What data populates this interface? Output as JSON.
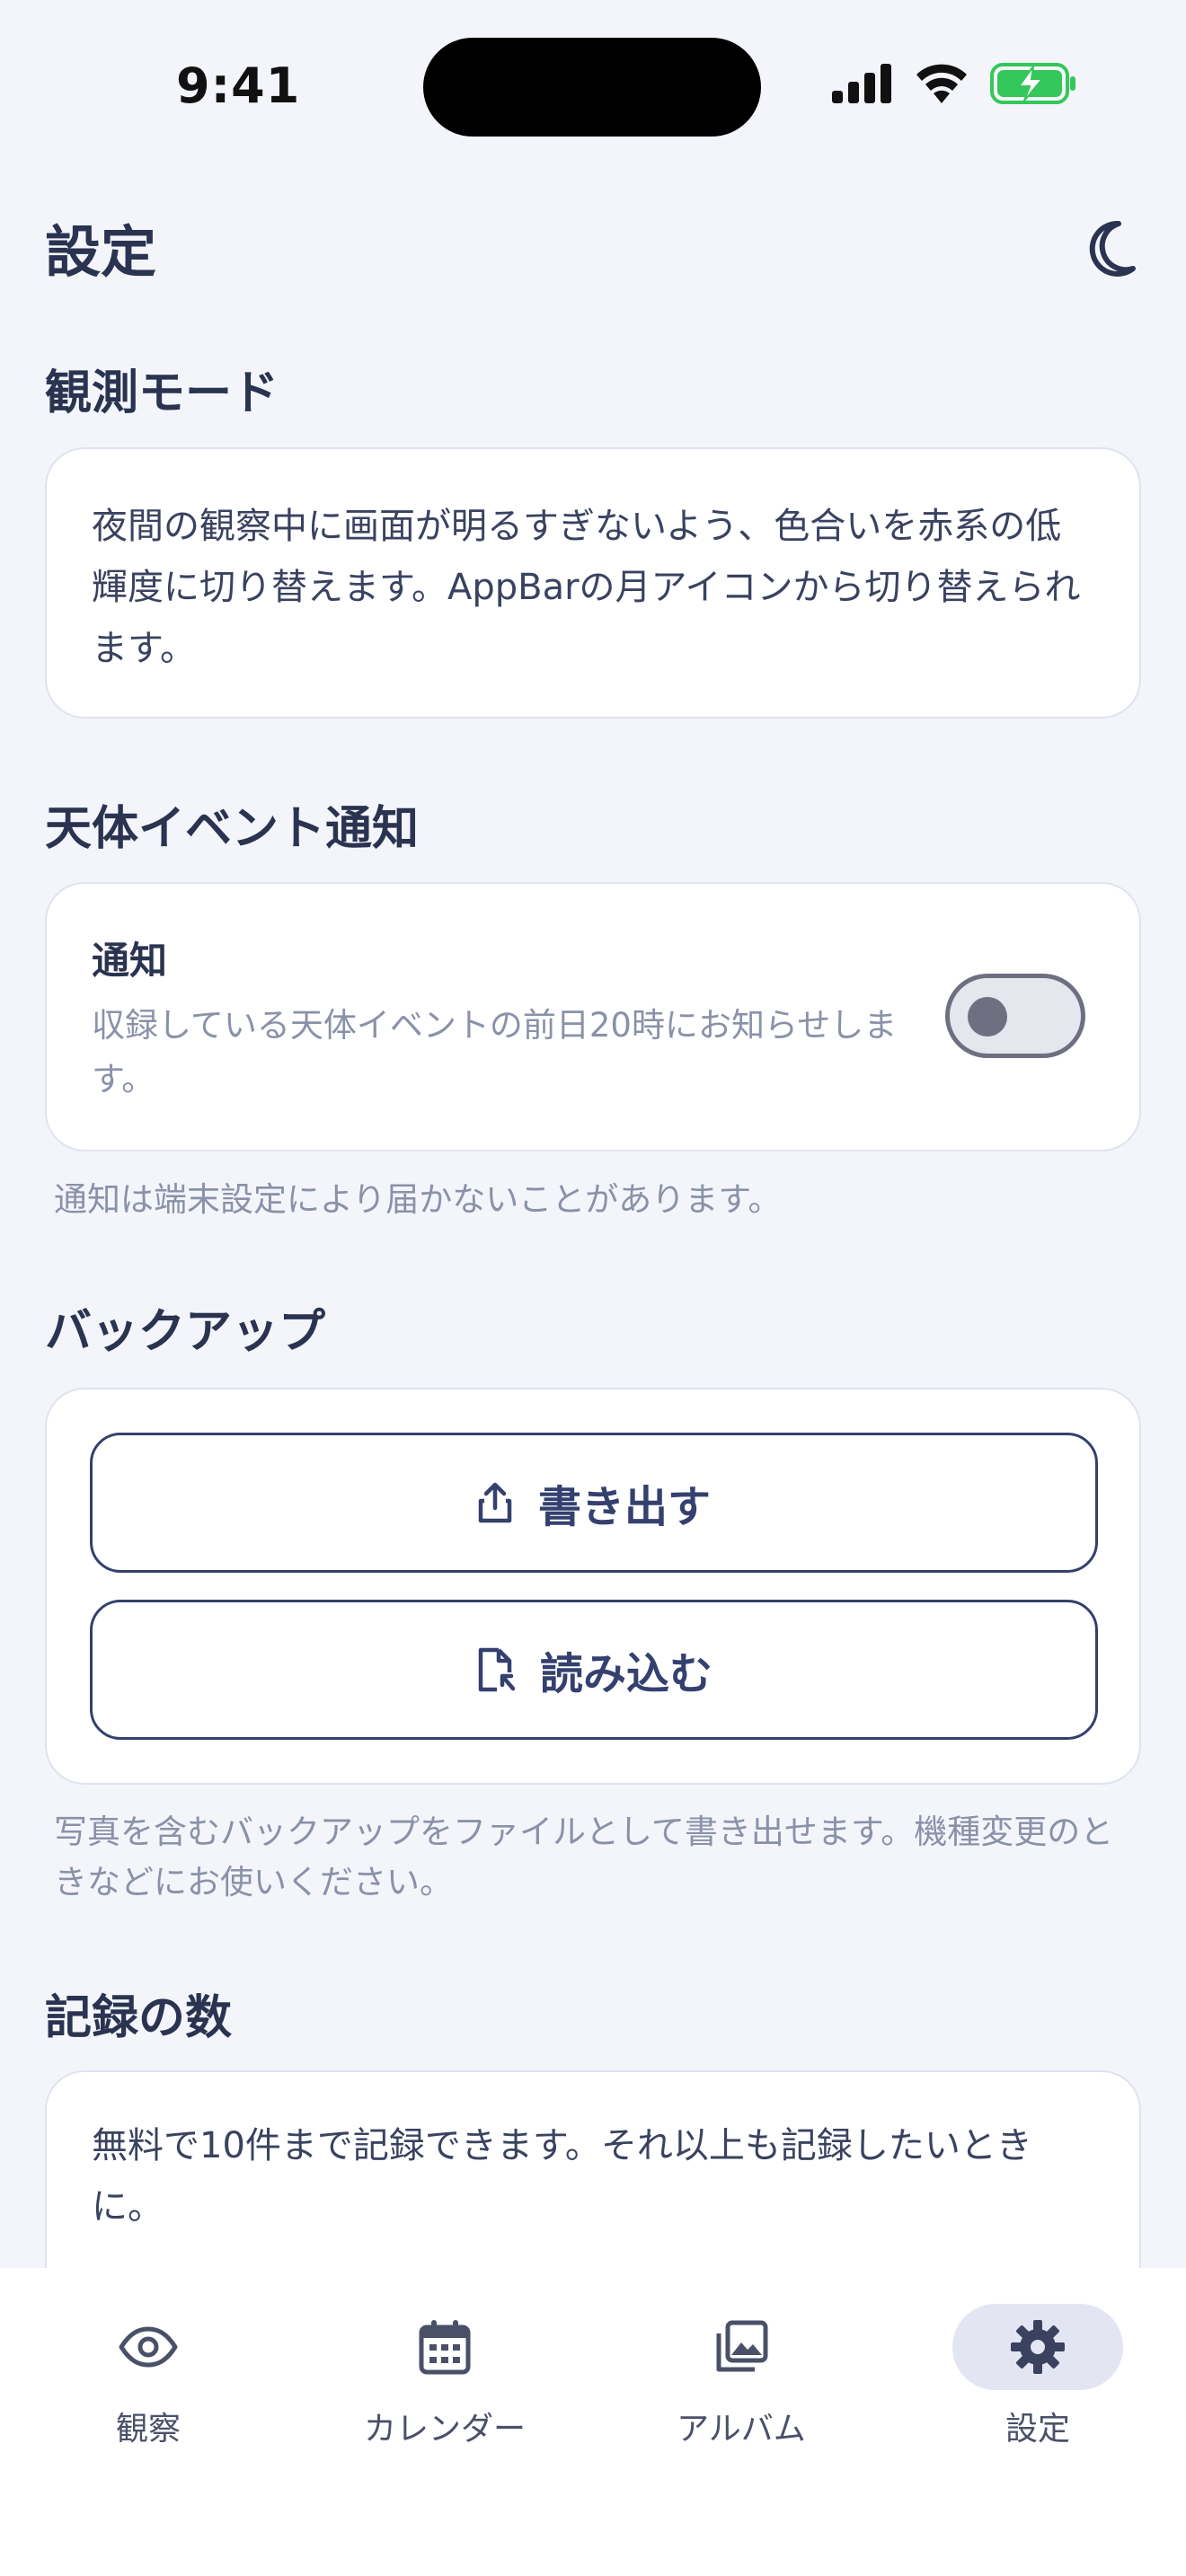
{
  "status_bar": {
    "time": "9:41"
  },
  "app_bar": {
    "title": "設定",
    "theme_icon": "moon-icon"
  },
  "observation_mode": {
    "title": "観測モード",
    "description": "夜間の観察中に画面が明るすぎないよう、色合いを赤系の低輝度に切り替えます。AppBarの月アイコンから切り替えられます。"
  },
  "notifications": {
    "title": "天体イベント通知",
    "label": "通知",
    "description": "収録している天体イベントの前日20時にお知らせします。",
    "enabled": false,
    "note": "通知は端末設定により届かないことがあります。"
  },
  "backup": {
    "title": "バックアップ",
    "export_label": "書き出す",
    "import_label": "読み込む",
    "note": "写真を含むバックアップをファイルとして書き出せます。機種変更のときなどにお使いください。"
  },
  "records": {
    "title": "記録の数",
    "description": "無料で10件まで記録できます。それ以上も記録したいときに。"
  },
  "bottom_nav": {
    "items": [
      {
        "label": "観察",
        "icon": "eye-icon"
      },
      {
        "label": "カレンダー",
        "icon": "calendar-icon"
      },
      {
        "label": "アルバム",
        "icon": "album-icon"
      },
      {
        "label": "設定",
        "icon": "gear-icon"
      }
    ],
    "active_index": 3
  },
  "colors": {
    "background": "#f3f5fa",
    "accent": "#34406e",
    "text": "#2a3350",
    "muted": "#8a91a8",
    "battery": "#34c759"
  }
}
